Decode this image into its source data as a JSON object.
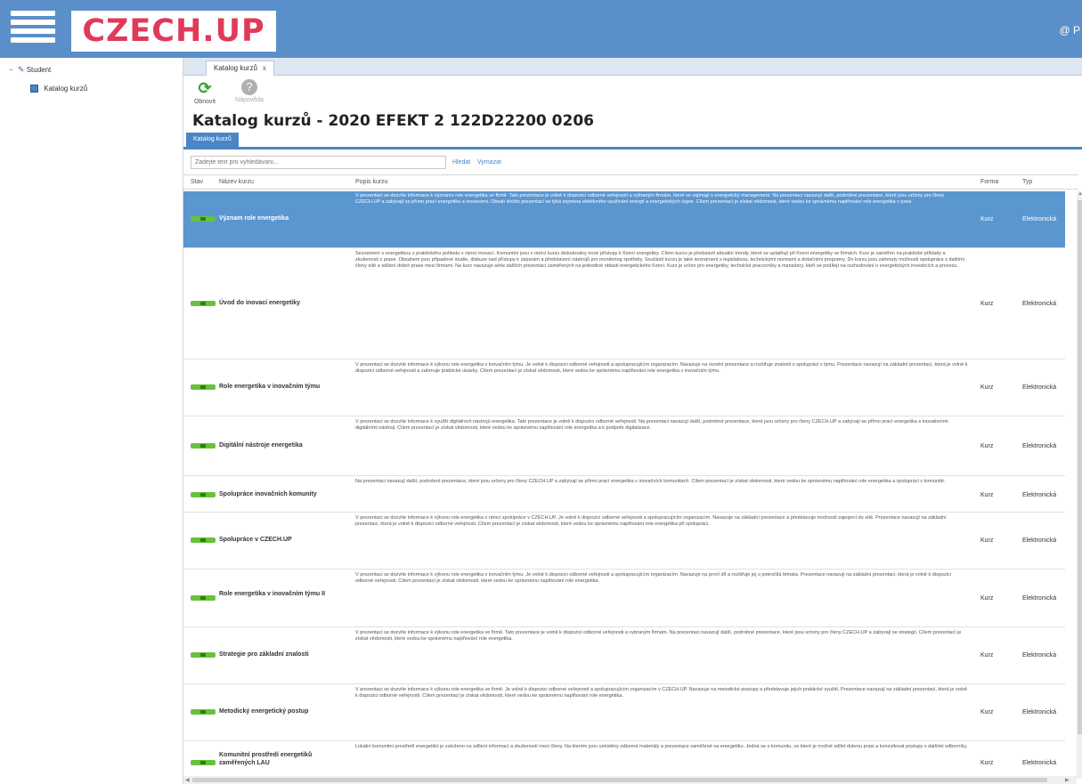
{
  "app": {
    "brand": "CZECH.UP",
    "user_label": "@ P"
  },
  "sidebar": {
    "items": [
      {
        "label": "Student"
      },
      {
        "label": "Katalog kurzů"
      }
    ]
  },
  "tabs": [
    {
      "label": "Katalog kurzů",
      "close": "x"
    }
  ],
  "toolbar": {
    "refresh_label": "Obnovit",
    "help_label": "Nápověda"
  },
  "page": {
    "title": "Katalog kurzů - 2020 EFEKT 2 122D22200 0206"
  },
  "subtab": {
    "label": "Katalog kurzů"
  },
  "search": {
    "placeholder": "Zadejte text pro vyhledávání...",
    "search_label": "Hledat",
    "clear_label": "Vymazat"
  },
  "grid": {
    "columns": {
      "status": "Stav",
      "name": "Název kurzu",
      "description": "Popis kurzu",
      "form": "Forma",
      "type": "Typ"
    },
    "rows": [
      {
        "name": "Význam role energetika",
        "form": "Kurz",
        "type": "Elektronická",
        "selected": true,
        "description": "V prezentaci se dozvíte informace k významu role energetika ve firmě. Tato prezentace je volně k dispozici odborné veřejnosti a vybraným firmám, které se zajímají o energetický management. Na prezentaci navazují další, podrobné prezentace, které jsou určeny pro členy CZECH.UP a zabývají se přímo prací energetika a inovacemi. Obsah těchto prezentací se týká zejména efektivního využívání energií a energetických úspor. Cílem prezentací je získat vědomosti, které vedou ke správnému naplňování role energetika v praxi."
      },
      {
        "name": "Úvod do inovací energetiky",
        "form": "Kurz",
        "type": "Elektronická",
        "selected": false,
        "description": "Seznámení s energetikou z praktického pohledu v rámci inovací. Komunitní jsou v rámci kurzu diskutovány nové přístupy k řízení energetiky. Cílem kurzu je představit aktuální trendy, které se uplatňují při řízení energetiky ve firmách. Kurz je zaměřen na praktické příklady a zkušenosti z praxe. Obsahem jsou případové studie, diskuze nad přístupy k úsporám a představení nástrojů pro monitoring spotřeby. Součástí kurzu je také seznámení s legislativou, technickými normami a dotačními programy. Do kurzu jsou zahrnuty možnosti spolupráce s dalšími členy sítě a sdílení dobré praxe mezi firmami. Na kurz navazuje série dalších prezentací zaměřených na jednotlivé oblasti energetického řízení. Kurz je určen pro energetiky, technické pracovníky a manažery, kteří se podílejí na rozhodování o energetických investicích a provozu."
      },
      {
        "name": "Role energetika v inovačním týmu",
        "form": "Kurz",
        "type": "Elektronická",
        "selected": false,
        "description": "V prezentaci se dozvíte informace k výkonu role energetika v inovačním týmu. Je volně k dispozici odborné veřejnosti a spolupracujícím organizacím. Navazuje na úvodní prezentace a rozšiřuje znalosti o spolupráci v týmu. Prezentace navazují na základní prezentaci, která je volně k dispozici odborné veřejnosti a zahrnuje praktické ukázky. Cílem prezentací je získat vědomosti, které vedou ke správnému naplňování role energetika v inovačním týmu."
      },
      {
        "name": "Digitální nástroje energetika",
        "form": "Kurz",
        "type": "Elektronická",
        "selected": false,
        "description": "V prezentaci se dozvíte informace k využití digitálních nástrojů energetika. Tato prezentace je volně k dispozici odborné veřejnosti. Na prezentaci navazují další, podrobné prezentace, které jsou určeny pro členy CZECH.UP a zabývají se přímo prací energetika s inovativními digitálními nástroji. Cílem prezentací je získat vědomosti, které vedou ke správnému naplňování role energetika a k podpoře digitalizace."
      },
      {
        "name": "Spolupráce inovačních komunity",
        "form": "Kurz",
        "type": "Elektronická",
        "selected": false,
        "description": "Na prezentaci navazují další, podrobné prezentace, které jsou určeny pro členy CZECH.UP a zabývají se přímo prací energetika v inovačních komunitách. Cílem prezentací je získat vědomosti, které vedou ke správnému naplňování role energetika a spolupráci v komunitě."
      },
      {
        "name": "Spolupráce v CZECH.UP",
        "form": "Kurz",
        "type": "Elektronická",
        "selected": false,
        "description": "V prezentaci se dozvíte informace k výkonu role energetika v rámci spolupráce v CZECH.UP. Je volně k dispozici odborné veřejnosti a spolupracujícím organizacím. Navazuje na základní prezentace a představuje možnosti zapojení do sítě. Prezentace navazují na základní prezentaci, která je volně k dispozici odborné veřejnosti. Cílem prezentací je získat vědomosti, které vedou ke správnému naplňování role energetika při spolupráci."
      },
      {
        "name": "Role energetika v inovačním týmu II",
        "form": "Kurz",
        "type": "Elektronická",
        "selected": false,
        "description": "V prezentaci se dozvíte informace k výkonu role energetika v inovačním týmu. Je volně k dispozici odborné veřejnosti a spolupracujícím organizacím. Navazuje na první díl a rozšiřuje jej o pokročilá témata. Prezentace navazují na základní prezentaci, která je volně k dispozici odborné veřejnosti. Cílem prezentací je získat vědomosti, které vedou ke správnému naplňování role energetika."
      },
      {
        "name": "Strategie pro základní znalosti",
        "form": "Kurz",
        "type": "Elektronická",
        "selected": false,
        "description": "V prezentaci se dozvíte informace k výkonu role energetika ve firmě. Tato prezentace je volně k dispozici odborné veřejnosti a vybraným firmám. Na prezentaci navazují další, podrobné prezentace, které jsou určeny pro členy CZECH.UP a zabývají se strategií. Cílem prezentací je získat vědomosti, které vedou ke správnému naplňování role energetika."
      },
      {
        "name": "Metodický energetický postup",
        "form": "Kurz",
        "type": "Elektronická",
        "selected": false,
        "description": "V prezentaci se dozvíte informace k výkonu role energetika ve firmě. Je volně k dispozici odborné veřejnosti a spolupracujícím organizacím v CZECH.UP. Navazuje na metodické postupy a představuje jejich praktické využití. Prezentace navazují na základní prezentaci, která je volně k dispozici odborné veřejnosti. Cílem prezentací je získat vědomosti, které vedou ke správnému naplňování role energetika."
      },
      {
        "name": "Komunitní prostředí energetiků zaměřených LAU",
        "form": "Kurz",
        "type": "Elektronická",
        "selected": false,
        "description": "Lokální komunitní prostředí energetiků je založeno na sdílení informací a zkušeností mezi členy. Na kterém jsou umístěny odborné materiály a prezentace zaměřené na energetiku. Jedná se o komunitu, ve které je možné sdílet dobrou praxi a konzultovat postupy s dalšími odborníky."
      }
    ]
  }
}
